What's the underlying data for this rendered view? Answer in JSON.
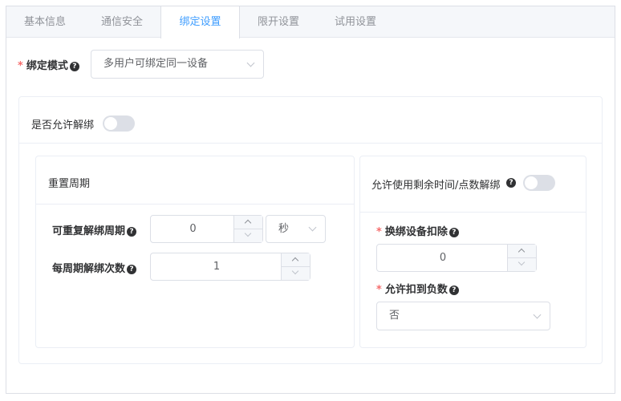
{
  "tabs": [
    {
      "label": "基本信息",
      "active": false
    },
    {
      "label": "通信安全",
      "active": false
    },
    {
      "label": "绑定设置",
      "active": true
    },
    {
      "label": "限开设置",
      "active": false
    },
    {
      "label": "试用设置",
      "active": false
    }
  ],
  "bind_mode": {
    "required_mark": "*",
    "label": "绑定模式",
    "help": "?",
    "value": "多用户可绑定同一设备"
  },
  "allow_unbind": {
    "label": "是否允许解绑",
    "enabled": false
  },
  "reset_period": {
    "title": "重置周期",
    "repeat_period": {
      "label": "可重复解绑周期",
      "help": "?",
      "value": "0",
      "unit": "秒"
    },
    "per_period": {
      "label": "每周期解绑次数",
      "help": "?",
      "value": "1"
    }
  },
  "remaining": {
    "label": "允许使用剩余时间/点数解绑",
    "help": "?",
    "enabled": false,
    "deduct": {
      "required_mark": "*",
      "label": "换绑设备扣除",
      "help": "?",
      "value": "0"
    },
    "negative": {
      "required_mark": "*",
      "label": "允许扣到负数",
      "help": "?",
      "value": "否"
    }
  },
  "colors": {
    "accent": "#409eff",
    "required": "#f56c6c",
    "border": "#dcdfe6",
    "switch_off": "#dcdfe6"
  }
}
